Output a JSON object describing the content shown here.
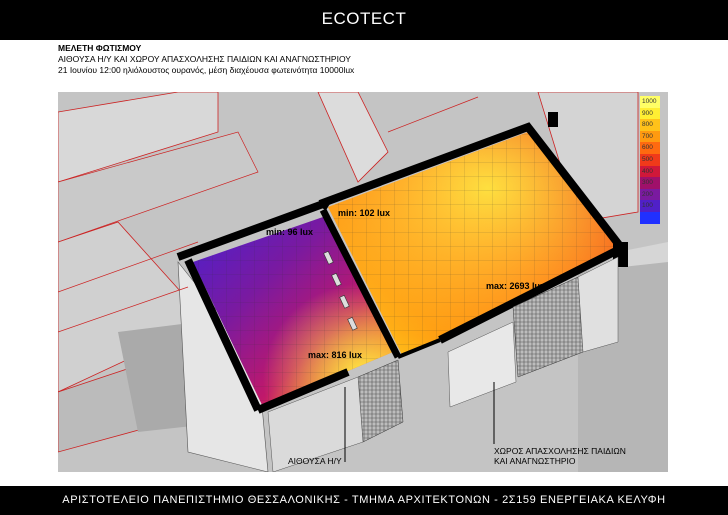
{
  "header": {
    "title": "ECOTECT"
  },
  "info": {
    "line1": "ΜΕΛΕΤΗ ΦΩΤΙΣΜΟΥ",
    "line2": "ΑΙΘΟΥΣΑ Η/Υ ΚΑΙ ΧΩΡΟΥ ΑΠΑΣΧΟΛΗΣΗΣ ΠΑΙΔΙΩΝ ΚΑΙ ΑΝΑΓΝΩΣΤΗΡΙΟΥ",
    "line3": "21 Ιουνίου 12:00 ηλιόλουστος ουρανός, μέση διαχέουσα φωτεινότητα 10000lux"
  },
  "legend": [
    {
      "label": "1000",
      "color": "#ffff66"
    },
    {
      "label": "900",
      "color": "#ffee33"
    },
    {
      "label": "800",
      "color": "#ffc21a"
    },
    {
      "label": "700",
      "color": "#ff9a10"
    },
    {
      "label": "600",
      "color": "#ff6a10"
    },
    {
      "label": "500",
      "color": "#f03a1a"
    },
    {
      "label": "400",
      "color": "#d0183a"
    },
    {
      "label": "300",
      "color": "#a0106a"
    },
    {
      "label": "200",
      "color": "#7a1aa0"
    },
    {
      "label": "100",
      "color": "#5020c8"
    },
    {
      "label": "",
      "color": "#2030ff"
    }
  ],
  "annotations": {
    "min_left": "min: 96 lux",
    "min_right": "min: 102 lux",
    "max_right": "max: 2693 lux",
    "max_left": "max: 816 lux"
  },
  "captions": {
    "room_left": "ΑΙΘΟΥΣΑ Η/Υ",
    "room_right_1": "ΧΩΡΟΣ ΑΠΑΣΧΟΛΗΣΗΣ ΠΑΙΔΙΩΝ",
    "room_right_2": "ΚΑΙ ΑΝΑΓΝΩΣΤΗΡΙΟ"
  },
  "footer": {
    "text": "ΑΡΙΣΤΟΤΕΛΕΙΟ ΠΑΝΕΠΙΣΤΗΜΙΟ ΘΕΣΣΑΛΟΝΙΚΗΣ - ΤΜΗΜΑ ΑΡΧΙΤΕΚΤΟΝΩΝ - 2Σ159 ΕΝΕΡΓΕΙΑΚΑ ΚΕΛΥΦΗ"
  }
}
